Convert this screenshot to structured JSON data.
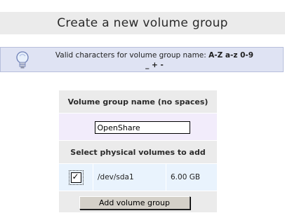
{
  "page": {
    "title": "Create a new volume group"
  },
  "info": {
    "prefix": "Valid characters for volume group name: ",
    "chars_bold": "A-Z a-z 0-9",
    "chars_line2": "_ + -",
    "icon": "lightbulb-icon"
  },
  "form": {
    "name_header": "Volume group name (no spaces)",
    "name_value": "OpenShare",
    "pv_header": "Select physical volumes to add",
    "volumes": [
      {
        "checked": true,
        "device": "/dev/sda1",
        "size": "6.00 GB"
      }
    ],
    "submit_label": "Add volume group"
  }
}
